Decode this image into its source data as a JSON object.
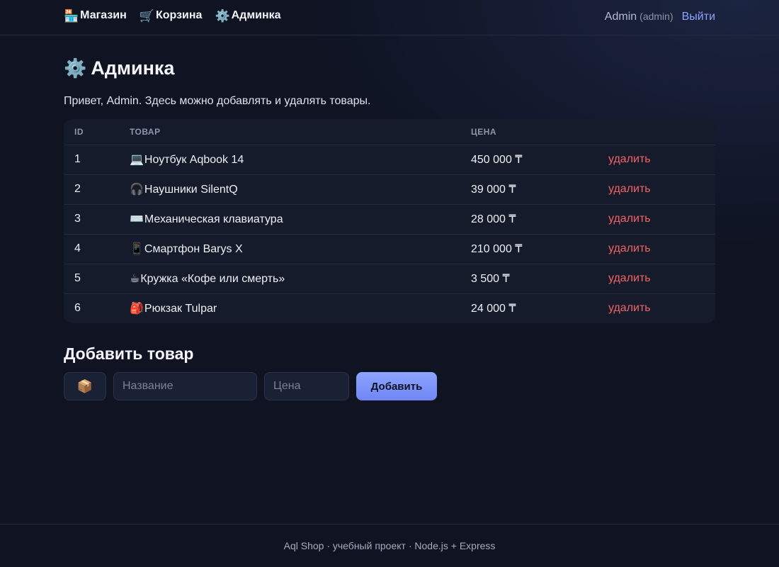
{
  "nav": {
    "items": [
      {
        "icon": "🏪",
        "label": "Магазин"
      },
      {
        "icon": "🛒",
        "label": "Корзина"
      },
      {
        "icon": "⚙️",
        "label": "Админка"
      }
    ]
  },
  "user": {
    "name": "Admin",
    "role": "(admin)",
    "logout": "Выйти"
  },
  "page": {
    "title_icon": "⚙️",
    "title": "Админка",
    "intro": "Привет, Admin. Здесь можно добавлять и удалять товары."
  },
  "table": {
    "headers": [
      "ID",
      "ТОВАР",
      "ЦЕНА",
      ""
    ],
    "delete_label": "удалить",
    "rows": [
      {
        "id": "1",
        "emoji": "💻",
        "name": "Ноутбук Aqbook 14",
        "price": "450 000 ₸"
      },
      {
        "id": "2",
        "emoji": "🎧",
        "name": "Наушники SilentQ",
        "price": "39 000 ₸"
      },
      {
        "id": "3",
        "emoji": "⌨️",
        "name": "Механическая клавиатура",
        "price": "28 000 ₸"
      },
      {
        "id": "4",
        "emoji": "📱",
        "name": "Смартфон Barys X",
        "price": "210 000 ₸"
      },
      {
        "id": "5",
        "emoji": "☕",
        "name": "Кружка «Кофе или смерть»",
        "price": "3 500 ₸"
      },
      {
        "id": "6",
        "emoji": "🎒",
        "name": "Рюкзак Tulpar",
        "price": "24 000 ₸"
      }
    ]
  },
  "add_form": {
    "title": "Добавить товар",
    "emoji_value": "📦",
    "name_placeholder": "Название",
    "price_placeholder": "Цена",
    "submit_label": "Добавить"
  },
  "footer": {
    "text": "Aql Shop · учебный проект · Node.js + Express"
  },
  "colors": {
    "background": "#0f1322",
    "accent": "#8fa2ff",
    "danger": "#f06363"
  }
}
